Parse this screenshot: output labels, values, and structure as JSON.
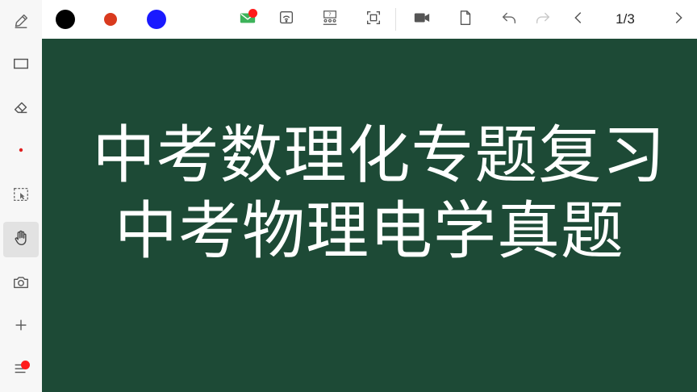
{
  "toolbar": {
    "pen_colors": [
      "#000000",
      "#d93a1e",
      "#1a1aff"
    ],
    "page_indicator": "1/3"
  },
  "sidebar": {
    "tools": [
      "pen",
      "rectangle",
      "eraser",
      "dot",
      "select",
      "hand",
      "camera",
      "add",
      "menu"
    ],
    "active_tool": "hand"
  },
  "board": {
    "background": "#1d4a36",
    "lines": [
      "中考数理化专题复习",
      "中考物理电学真题"
    ]
  }
}
